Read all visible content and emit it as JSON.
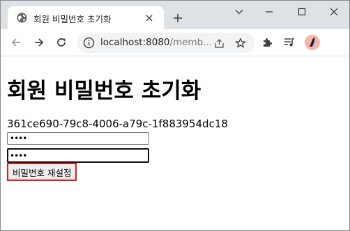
{
  "browser": {
    "tab_title": "회원 비밀번호 초기화",
    "url_host": "localhost:8080",
    "url_path": "/memb...",
    "icons": [
      "globe-icon",
      "close-icon",
      "plus-icon",
      "chevron-down-icon",
      "minimize-icon",
      "maximize-icon",
      "window-close-icon",
      "back-icon",
      "forward-icon",
      "reload-icon",
      "info-icon",
      "share-icon",
      "star-icon",
      "extensions-icon",
      "media-icon",
      "profile-avatar"
    ]
  },
  "page": {
    "title": "회원 비밀번호 초기화",
    "token": "361ce690-79c8-4006-a79c-1f883954dc18",
    "password_value": "••••",
    "password_confirm_value": "••••",
    "reset_button_label": "비밀번호 재설정",
    "highlight_color": "#e0201e"
  }
}
